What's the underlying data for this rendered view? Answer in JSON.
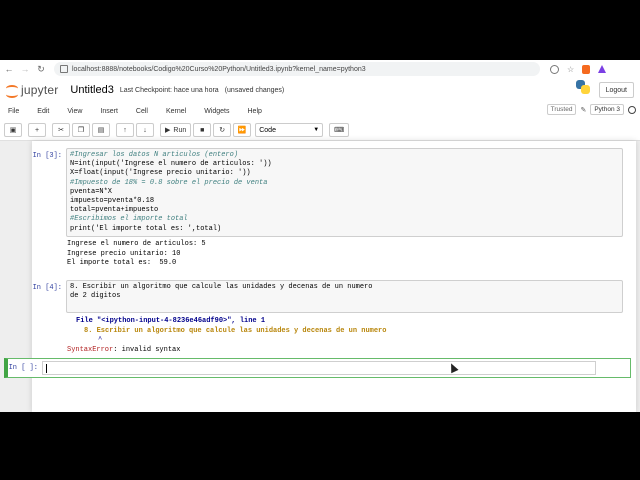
{
  "browser": {
    "url": "localhost:8888/notebooks/Codigo%20Curso%20Python/Untitled3.ipynb?kernel_name=python3"
  },
  "header": {
    "logo_text": "jupyter",
    "notebook_title": "Untitled3",
    "checkpoint": "Last Checkpoint: hace una hora",
    "unsaved": "(unsaved changes)",
    "logout_label": "Logout"
  },
  "menubar": {
    "items": [
      "File",
      "Edit",
      "View",
      "Insert",
      "Cell",
      "Kernel",
      "Widgets",
      "Help"
    ],
    "trusted": "Trusted",
    "kernel": "Python 3"
  },
  "toolbar": {
    "run_label": "Run",
    "cell_type": "Code"
  },
  "cells": [
    {
      "prompt": "In [3]:",
      "code_lines": [
        "#Ingresar los datos N articulos (entero)",
        "N=int(input('Ingrese el numero de articulos: '))",
        "X=float(input('Ingrese precio unitario: '))",
        "#Impuesto de 18% = 0.8 sobre el precio de venta",
        "pventa=N*X",
        "impuesto=pventa*0.18",
        "total=pventa+impuesto",
        "#Escribimos el importe total",
        "print('El importe total es: ',total)"
      ],
      "output_lines": [
        "Ingrese el numero de articulos: 5",
        "Ingrese precio unitario: 10",
        "El importe total es:  59.0"
      ]
    },
    {
      "prompt": "In [4]:",
      "code_lines": [
        "8. Escribir un algoritmo que calcule las unidades y decenas de un numero",
        "de 2 digitos"
      ],
      "error": {
        "file_line": "File \"<ipython-input-4-8236e46adf90>\", line 1",
        "source": "8. Escribir un algoritmo que calcule las unidades y decenas de un numero",
        "caret": "^",
        "name": "SyntaxError",
        "message": ": invalid syntax"
      }
    },
    {
      "prompt": "In [ ]:"
    }
  ]
}
